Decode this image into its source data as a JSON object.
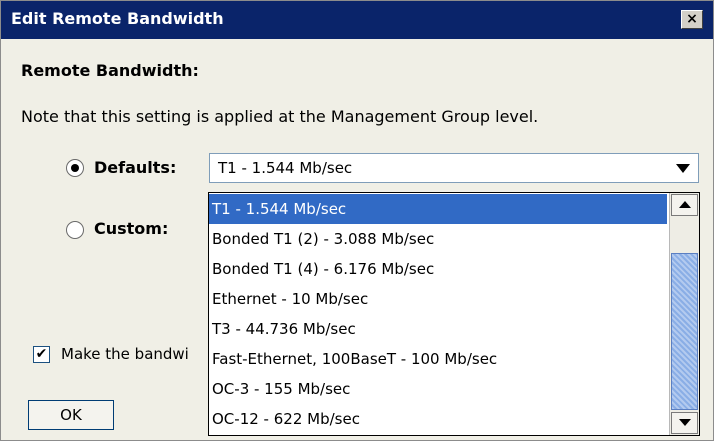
{
  "window": {
    "title": "Edit Remote Bandwidth",
    "close_glyph": "×"
  },
  "heading": "Remote Bandwidth:",
  "note": "Note that this setting is applied at the Management Group level.",
  "defaults": {
    "label": "Defaults:",
    "selected": true
  },
  "custom": {
    "label": "Custom:",
    "selected": false
  },
  "combo": {
    "value": "T1 - 1.544 Mb/sec",
    "arrow_icon": "chevron-down-icon"
  },
  "dropdown": {
    "options": [
      "T1 - 1.544 Mb/sec",
      "Bonded T1 (2) - 3.088 Mb/sec",
      "Bonded T1 (4) - 6.176 Mb/sec",
      "Ethernet - 10 Mb/sec",
      "T3 - 44.736 Mb/sec",
      "Fast-Ethernet, 100BaseT - 100 Mb/sec",
      "OC-3 - 155 Mb/sec",
      "OC-12 - 622 Mb/sec"
    ],
    "selected_index": 0
  },
  "checkbox": {
    "label": "Make the bandwi",
    "checked": true,
    "check_glyph": "✔"
  },
  "buttons": {
    "ok": "OK"
  },
  "colors": {
    "titlebar": "#0a246a",
    "selection": "#316ac5",
    "dialog_bg": "#f0efe6"
  }
}
